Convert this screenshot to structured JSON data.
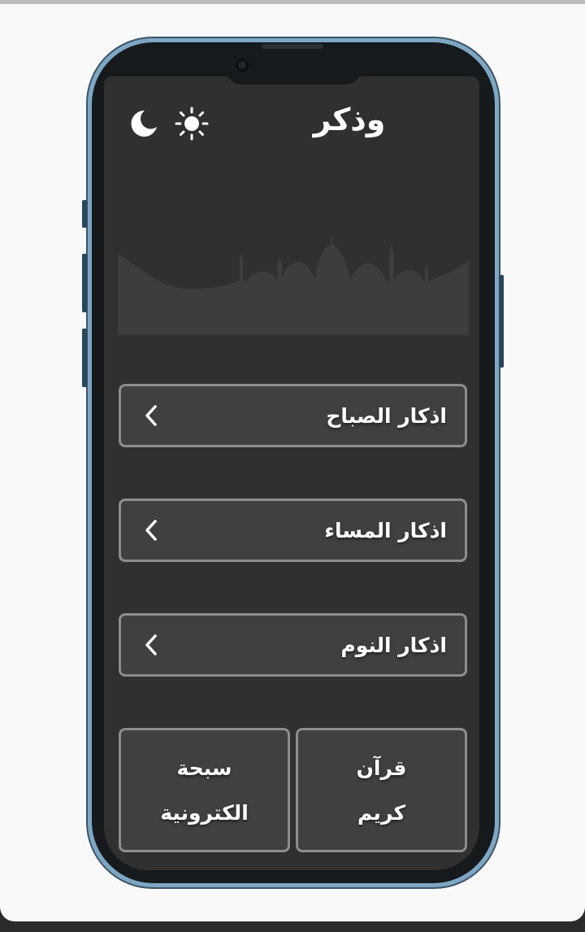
{
  "app": {
    "title": "وذكر"
  },
  "theme_toggle": {
    "light_icon": "sun-icon",
    "dark_icon": "moon-icon"
  },
  "hero": {
    "image_icon": "mosque-silhouette"
  },
  "menu": {
    "items": [
      {
        "label": "اذكار الصباح",
        "icon": "chevron-left-icon"
      },
      {
        "label": "اذكار المساء",
        "icon": "chevron-left-icon"
      },
      {
        "label": "اذكار النوم",
        "icon": "chevron-left-icon"
      }
    ]
  },
  "tiles": {
    "quran": {
      "line1": "قرآن",
      "line2": "كريم"
    },
    "tasbih": {
      "line1": "سبحة",
      "line2": "الكترونية"
    }
  },
  "colors": {
    "screen_bg": "#303030",
    "card_bg": "#404040",
    "card_border": "#8d8d8d",
    "text": "#ffffff",
    "phone_frame": "#7ea7c4"
  }
}
